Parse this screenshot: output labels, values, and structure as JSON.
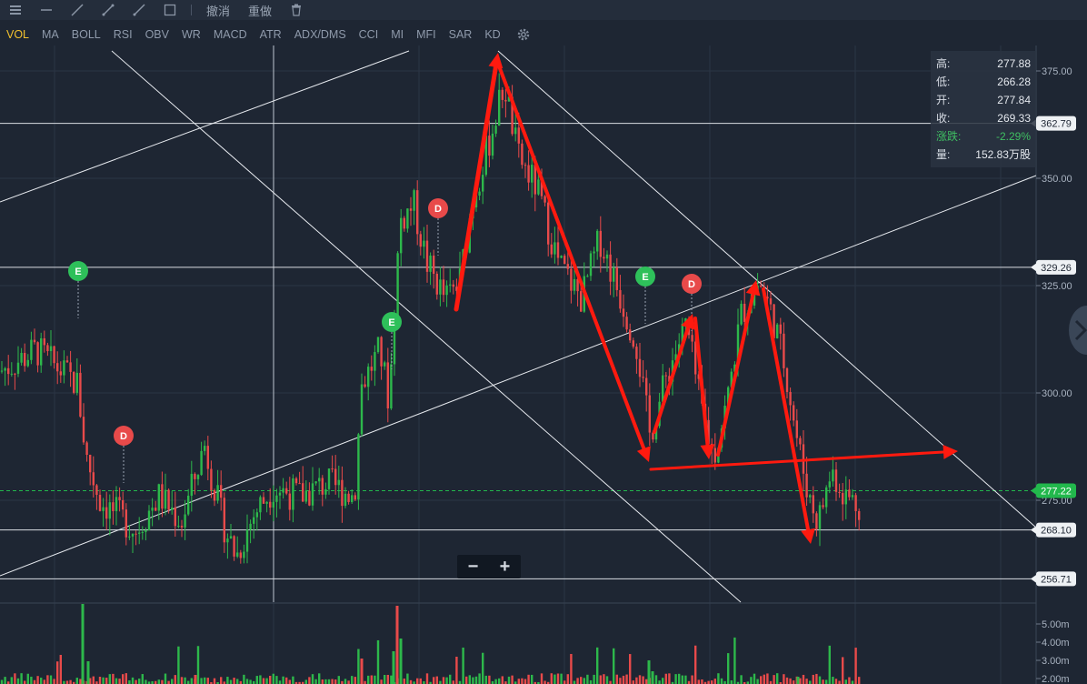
{
  "toolbar": {
    "undo_label": "撤消",
    "redo_label": "重做"
  },
  "indicators": [
    "VOL",
    "MA",
    "BOLL",
    "RSI",
    "OBV",
    "WR",
    "MACD",
    "ATR",
    "ADX/DMS",
    "CCI",
    "MI",
    "MFI",
    "SAR",
    "KD"
  ],
  "active_indicator": "VOL",
  "price_axis": {
    "ticks": [
      "375.00",
      "350.00",
      "325.00",
      "300.00",
      "275.00"
    ],
    "line_labels": [
      "362.79",
      "329.26",
      "268.10",
      "256.71"
    ],
    "current_price": "277.22"
  },
  "volume_axis": {
    "ticks": [
      "5.00m",
      "4.00m",
      "3.00m",
      "2.00m"
    ]
  },
  "info": {
    "high_label": "高:",
    "high": "277.88",
    "low_label": "低:",
    "low": "266.28",
    "open_label": "开:",
    "open": "277.84",
    "close_label": "收:",
    "close": "269.33",
    "change_label": "涨跌:",
    "change": "-2.29%",
    "volume_label": "量:",
    "volume": "152.83万股"
  },
  "markers": [
    {
      "letter": "E",
      "type": "earnings"
    },
    {
      "letter": "D",
      "type": "dividend"
    },
    {
      "letter": "E",
      "type": "earnings"
    },
    {
      "letter": "D",
      "type": "dividend"
    },
    {
      "letter": "E",
      "type": "earnings"
    },
    {
      "letter": "D",
      "type": "dividend"
    }
  ],
  "colors": {
    "up": "#2db84b",
    "down": "#e84a4a",
    "background": "#1e2633",
    "annotation": "#ff1a0f",
    "current_price": "#22b84c"
  },
  "zoom": {
    "minus": "−",
    "plus": "+"
  }
}
